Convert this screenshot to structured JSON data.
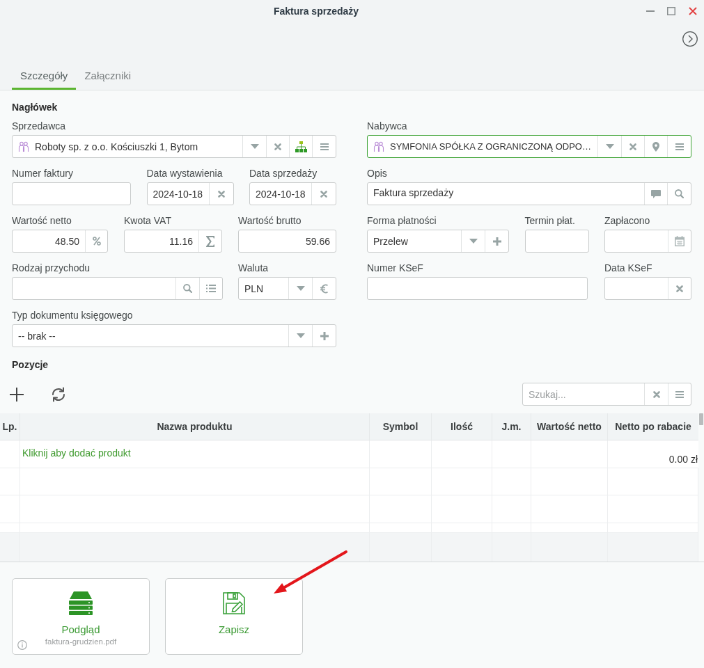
{
  "window": {
    "title": "Faktura sprzedaży"
  },
  "tabs": [
    {
      "label": "Szczegóły",
      "selected": true
    },
    {
      "label": "Załączniki",
      "selected": false
    }
  ],
  "header": {
    "title": "Nagłówek",
    "seller": {
      "label": "Sprzedawca",
      "value": "Roboty sp. z o.o. Kościuszki 1, Bytom",
      "focused": false
    },
    "buyer": {
      "label": "Nabywca",
      "value": "SYMFONIA SPÓŁKA Z OGRANICZONĄ ODPO…",
      "focused": true
    },
    "invoice_number": {
      "label": "Numer faktury"
    },
    "issue_date": {
      "label": "Data wystawienia",
      "value": "2024-10-18"
    },
    "sale_date": {
      "label": "Data sprzedaży",
      "value": "2024-10-18"
    },
    "description": {
      "label": "Opis",
      "value": "Faktura sprzedaży"
    },
    "net_value": {
      "label": "Wartość netto",
      "value": "48.50"
    },
    "vat_amount": {
      "label": "Kwota VAT",
      "value": "11.16"
    },
    "gross_value": {
      "label": "Wartość brutto",
      "value": "59.66"
    },
    "payment_method": {
      "label": "Forma płatności",
      "value": "Przelew"
    },
    "payment_term": {
      "label": "Termin płat."
    },
    "paid": {
      "label": "Zapłacono"
    },
    "income_type": {
      "label": "Rodzaj przychodu"
    },
    "currency": {
      "label": "Waluta",
      "value": "PLN"
    },
    "ksef_number": {
      "label": "Numer KSeF"
    },
    "ksef_date": {
      "label": "Data KSeF"
    },
    "document_type": {
      "label": "Typ dokumentu księgowego",
      "value": "-- brak --"
    }
  },
  "items": {
    "title": "Pozycje",
    "search": {
      "placeholder": "Szukaj..."
    },
    "table": {
      "columns": [
        "Lp.",
        "Nazwa produktu",
        "Symbol",
        "Ilość",
        "J.m.",
        "Wartość netto",
        "Netto po rabacie"
      ],
      "add_row": {
        "prompt": "Kliknij aby dodać produkt",
        "net_after_discount": "0.00 zł"
      }
    }
  },
  "actions": [
    {
      "kind": "preview",
      "label": "Podgląd",
      "file": "faktura-grudzien.pdf"
    },
    {
      "kind": "save",
      "label": "Zapisz"
    }
  ]
}
